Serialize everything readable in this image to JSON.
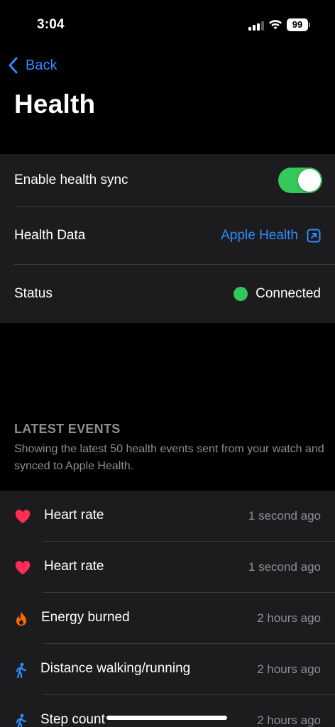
{
  "status_bar": {
    "time": "3:04",
    "battery": "99",
    "icons": [
      "signal-icon",
      "wifi-icon",
      "battery-icon"
    ]
  },
  "nav": {
    "back_label": "Back",
    "back_icon": "chevron-left-icon",
    "title": "Health"
  },
  "settings": {
    "sync_label": "Enable health sync",
    "sync_enabled": true,
    "health_data_label": "Health Data",
    "health_data_link": "Apple Health",
    "health_data_icon": "external-link-icon",
    "status_label": "Status",
    "status_value": "Connected"
  },
  "events_section": {
    "title": "LATEST EVENTS",
    "description": "Showing the latest 50 health events sent from your watch and synced to Apple Health.",
    "events": [
      {
        "label": "Heart rate",
        "time": "1 second ago",
        "icon": "heart-icon"
      },
      {
        "label": "Heart rate",
        "time": "1 second ago",
        "icon": "heart-icon"
      },
      {
        "label": "Energy burned",
        "time": "2 hours ago",
        "icon": "flame-icon"
      },
      {
        "label": "Distance walking/running",
        "time": "2 hours ago",
        "icon": "walking-icon"
      },
      {
        "label": "Step count",
        "time": "2 hours ago",
        "icon": "walking-icon"
      }
    ]
  },
  "colors": {
    "background": "#000000",
    "card": "#1c1c1e",
    "accent": "#2f8bff",
    "toggle_on": "#34c759",
    "status_connected": "#34c759",
    "heart": "#ff2d55",
    "flame": "#ff6a00",
    "walking": "#2f8bff",
    "secondary_text": "#8e8e93"
  }
}
